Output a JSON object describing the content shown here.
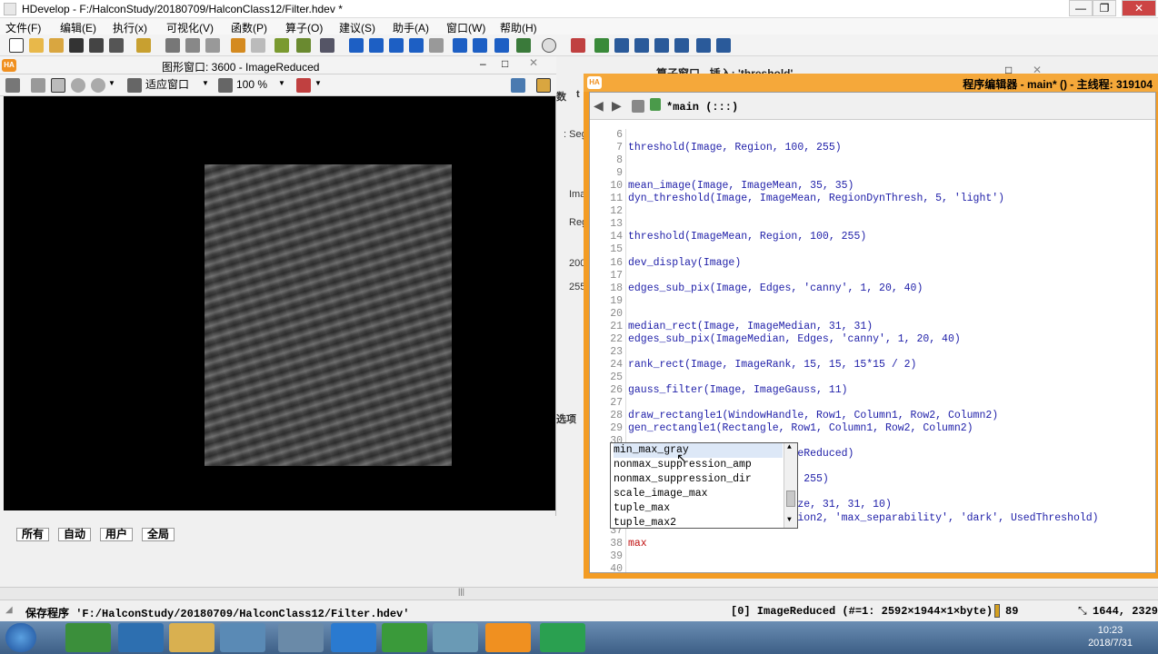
{
  "titlebar": {
    "title": "HDevelop - F:/HalconStudy/20180709/HalconClass12/Filter.hdev *",
    "min": "—",
    "max": "❐",
    "close": "✕"
  },
  "menu": [
    "文件(F)",
    "编辑(E)",
    "执行(x)",
    "可视化(V)",
    "函数(P)",
    "算子(O)",
    "建议(S)",
    "助手(A)",
    "窗口(W)",
    "帮助(H)"
  ],
  "graphics_window": {
    "title": "图形窗口: 3600 - ImageReduced",
    "fit_label": "适应窗口",
    "zoom_label": "100 %"
  },
  "operator_window": {
    "title_partial": "算子窗口 - 插入: 'threshold'",
    "cut_labels": [
      "数",
      "t",
      ": Seg",
      "Ima",
      "Reg",
      "200",
      "255",
      "选项"
    ]
  },
  "editor": {
    "title": "程序编辑器 - main* () - 主线程: 319104",
    "procedure": "*main (:::)",
    "lines": [
      {
        "n": "6",
        "t": ""
      },
      {
        "n": "7",
        "t": "threshold(Image, Region, 100, 255)"
      },
      {
        "n": "8",
        "t": ""
      },
      {
        "n": "9",
        "t": ""
      },
      {
        "n": "10",
        "t": "mean_image(Image, ImageMean, 35, 35)"
      },
      {
        "n": "11",
        "t": "dyn_threshold(Image, ImageMean, RegionDynThresh, 5, 'light')"
      },
      {
        "n": "12",
        "t": ""
      },
      {
        "n": "13",
        "t": ""
      },
      {
        "n": "14",
        "t": "threshold(ImageMean, Region, 100, 255)"
      },
      {
        "n": "15",
        "t": ""
      },
      {
        "n": "16",
        "t": "dev_display(Image)"
      },
      {
        "n": "17",
        "t": ""
      },
      {
        "n": "18",
        "t": "edges_sub_pix(Image, Edges, 'canny', 1, 20, 40)"
      },
      {
        "n": "19",
        "t": ""
      },
      {
        "n": "20",
        "t": ""
      },
      {
        "n": "21",
        "t": "median_rect(Image, ImageMedian, 31, 31)"
      },
      {
        "n": "22",
        "t": "edges_sub_pix(ImageMedian, Edges, 'canny', 1, 20, 40)"
      },
      {
        "n": "23",
        "t": ""
      },
      {
        "n": "24",
        "t": "rank_rect(Image, ImageRank, 15, 15, 15*15 / 2)"
      },
      {
        "n": "25",
        "t": ""
      },
      {
        "n": "26",
        "t": "gauss_filter(Image, ImageGauss, 11)"
      },
      {
        "n": "27",
        "t": ""
      },
      {
        "n": "28",
        "t": "draw_rectangle1(WindowHandle, Row1, Column1, Row2, Column2)"
      },
      {
        "n": "29",
        "t": "gen_rectangle1(Rectangle, Row1, Column1, Row2, Column2)"
      },
      {
        "n": "30",
        "t": ""
      },
      {
        "n": "31",
        "t": "                    e, ImageReduced)"
      },
      {
        "n": "32",
        "t": ""
      },
      {
        "n": "33",
        "t": "                    n1, 80, 255)"
      },
      {
        "n": "34",
        "t": ""
      },
      {
        "n": "35",
        "t": "                    Emphasize, 31, 31, 10)"
      },
      {
        "n": "36",
        "t": "                    ze, Region2, 'max_separability', 'dark', UsedThreshold)"
      },
      {
        "n": "37",
        "t": ""
      },
      {
        "n": "38",
        "t": "max"
      },
      {
        "n": "39",
        "t": ""
      },
      {
        "n": "40",
        "t": ""
      }
    ]
  },
  "autocomplete": {
    "items": [
      "min_max_gray",
      "nonmax_suppression_amp",
      "nonmax_suppression_dir",
      "scale_image_max",
      "tuple_max",
      "tuple_max2"
    ]
  },
  "bottom_tabs": [
    "所有",
    "自动",
    "用户",
    "全局"
  ],
  "statusbar": {
    "message": "保存程序 'F:/HalconStudy/20180709/HalconClass12/Filter.hdev'",
    "image_info": "[0] ImageReduced (#=1: 2592×1944×1×byte)",
    "gray": "89",
    "coords": "1644, 2329"
  },
  "taskbar": {
    "time": "10:23",
    "date": "2018/7/31"
  },
  "colors": {
    "editor_frame": "#f39c24",
    "code_text": "#1e1ea8",
    "current_line_text": "#c01010"
  }
}
